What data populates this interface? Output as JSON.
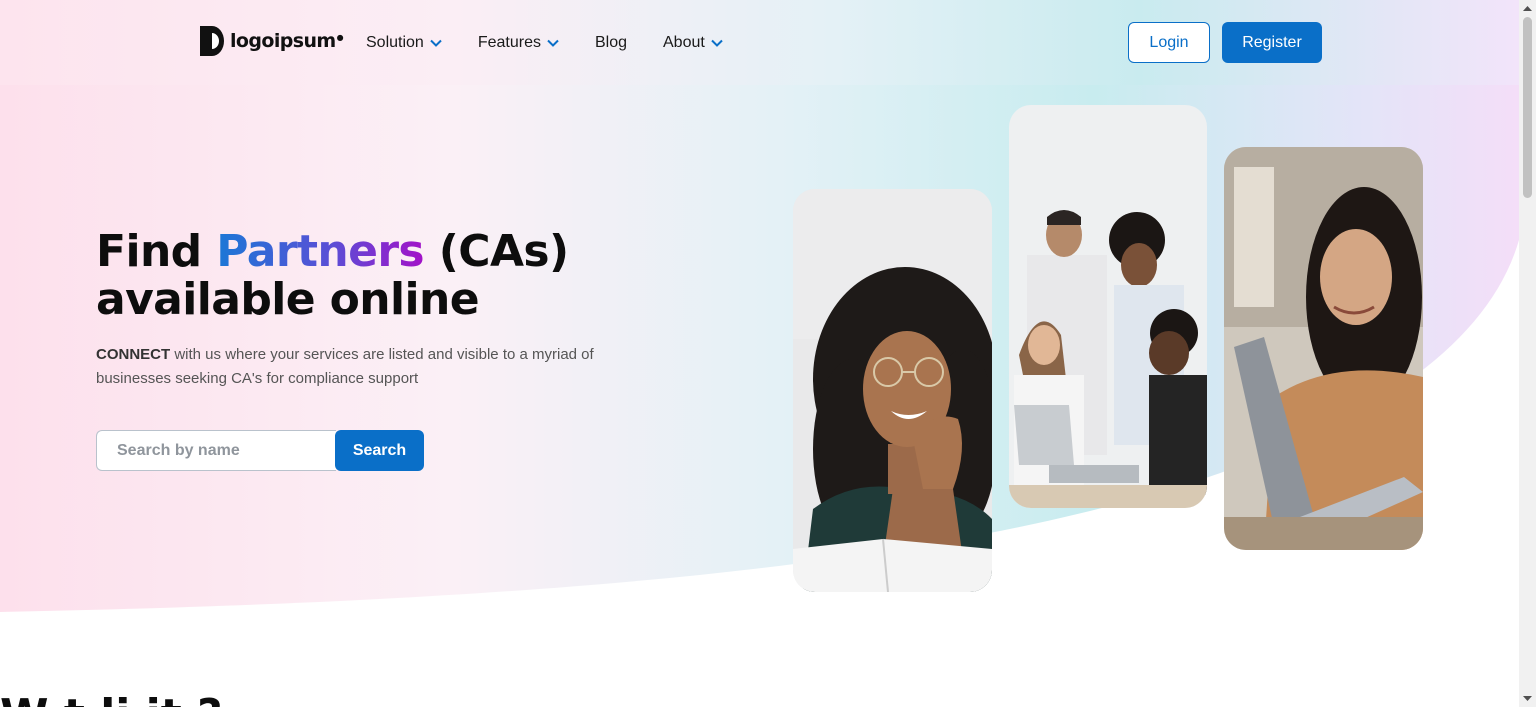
{
  "brand": {
    "logo_text": "logoipsum",
    "logo_mark": "registered-dot",
    "icon": "logo-icon"
  },
  "nav": {
    "items": [
      {
        "label": "Solution",
        "has_dropdown": true
      },
      {
        "label": "Features",
        "has_dropdown": true
      },
      {
        "label": "Blog",
        "has_dropdown": false
      },
      {
        "label": "About",
        "has_dropdown": true
      }
    ],
    "chevron_color": "#0a6fc8"
  },
  "auth": {
    "login_label": "Login",
    "register_label": "Register"
  },
  "hero": {
    "title_part1": "Find ",
    "title_accent": "Partners",
    "title_part2": " (CAs)",
    "title_line2": "available online",
    "sub_strong": "CONNECT",
    "sub_text": " with us where your services are listed and visible to a myriad of businesses seeking CA's for compliance support",
    "search_placeholder": "Search by name",
    "search_button": "Search"
  },
  "photos": [
    {
      "alt": "Smiling woman with curly hair resting chin on hand",
      "icon": "portrait-photo"
    },
    {
      "alt": "Team of four gathered around a laptop",
      "icon": "team-photo"
    },
    {
      "alt": "Young woman working on a laptop",
      "icon": "laptop-photo"
    }
  ],
  "next_section": {
    "heading_visible": "W      t  li  it  ?"
  },
  "colors": {
    "primary": "#0a6fc8",
    "accent_gradient_start": "#1b78d6",
    "accent_gradient_end": "#a312c8",
    "hero_pink": "#fde4ee",
    "hero_teal": "#c9ebef"
  }
}
